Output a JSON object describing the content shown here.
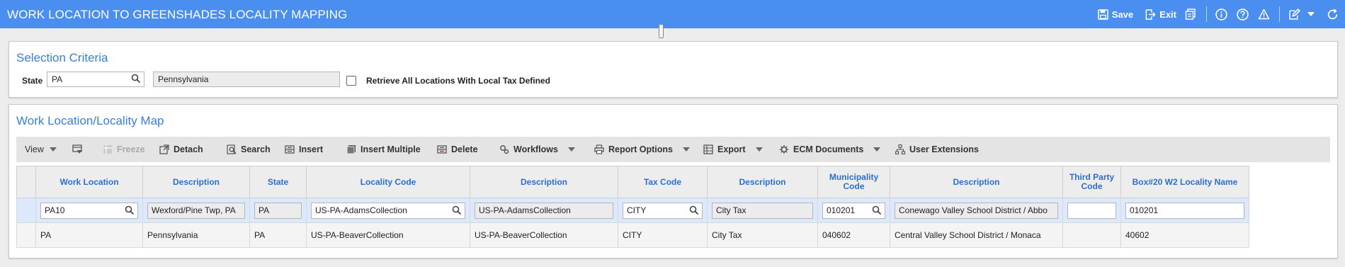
{
  "app": {
    "title": "WORK LOCATION TO GREENSHADES LOCALITY MAPPING",
    "save_label": "Save",
    "exit_label": "Exit"
  },
  "selection": {
    "heading": "Selection Criteria",
    "state_label": "State",
    "state_value": "PA",
    "state_name": "Pennsylvania",
    "retrieve_all_label": "Retrieve All Locations With Local Tax Defined"
  },
  "map": {
    "heading": "Work Location/Locality Map",
    "toolbar": {
      "view": "View",
      "freeze": "Freeze",
      "detach": "Detach",
      "search": "Search",
      "insert": "Insert",
      "insert_multiple": "Insert Multiple",
      "delete": "Delete",
      "workflows": "Workflows",
      "report_options": "Report Options",
      "export": "Export",
      "ecm_documents": "ECM Documents",
      "user_extensions": "User Extensions"
    },
    "columns": {
      "work_location": "Work Location",
      "description": "Description",
      "state": "State",
      "locality_code": "Locality Code",
      "locality_description": "Description",
      "tax_code": "Tax Code",
      "tax_description": "Description",
      "municipality_code": "Municipality Code",
      "municipality_description": "Description",
      "third_party_code": "Third Party Code",
      "box20_name": "Box#20 W2 Locality Name"
    },
    "rows": [
      {
        "work_location": "PA10",
        "description": "Wexford/Pine Twp, PA",
        "state": "PA",
        "locality_code": "US-PA-AdamsCollection",
        "locality_description": "US-PA-AdamsCollection",
        "tax_code": "CITY",
        "tax_description": "City Tax",
        "municipality_code": "010201",
        "municipality_description": "Conewago Valley School District / Abbo",
        "third_party_code": "",
        "box20_name": "010201"
      },
      {
        "work_location": "PA",
        "description": "Pennsylvania",
        "state": "PA",
        "locality_code": "US-PA-BeaverCollection",
        "locality_description": "US-PA-BeaverCollection",
        "tax_code": "CITY",
        "tax_description": "City Tax",
        "municipality_code": "040602",
        "municipality_description": "Central Valley School District / Monaca",
        "third_party_code": "",
        "box20_name": "40602"
      }
    ]
  }
}
